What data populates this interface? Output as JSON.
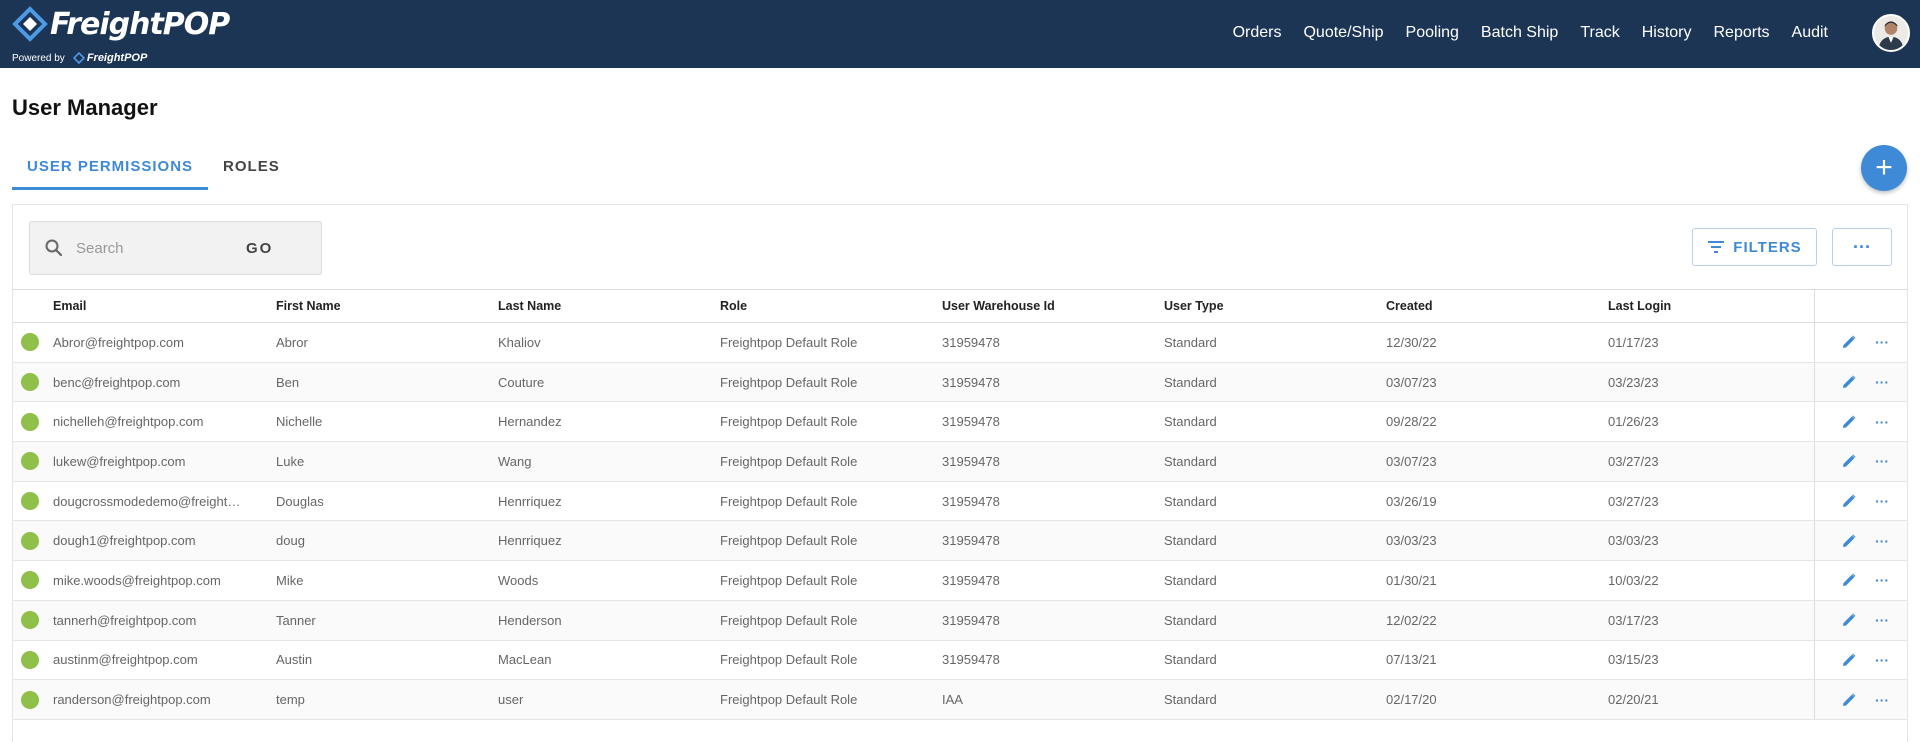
{
  "header": {
    "brand": "FreightPOP",
    "powered_by": "Powered by",
    "powered_brand": "FreightPOP",
    "nav": [
      "Orders",
      "Quote/Ship",
      "Pooling",
      "Batch Ship",
      "Track",
      "History",
      "Reports",
      "Audit"
    ]
  },
  "page": {
    "title": "User Manager",
    "tabs": [
      {
        "label": "USER PERMISSIONS",
        "active": true
      },
      {
        "label": "ROLES",
        "active": false
      }
    ],
    "add_button": "+"
  },
  "toolbar": {
    "search_placeholder": "Search",
    "go_label": "GO",
    "filters_label": "FILTERS",
    "more_label": "···"
  },
  "table": {
    "columns": [
      "Email",
      "First Name",
      "Last Name",
      "Role",
      "User Warehouse Id",
      "User Type",
      "Created",
      "Last Login"
    ],
    "rows": [
      {
        "email": "Abror@freightpop.com",
        "first": "Abror",
        "last": "Khaliov",
        "role": "Freightpop Default Role",
        "warehouse": "31959478",
        "type": "Standard",
        "created": "12/30/22",
        "login": "01/17/23"
      },
      {
        "email": "benc@freightpop.com",
        "first": "Ben",
        "last": "Couture",
        "role": "Freightpop Default Role",
        "warehouse": "31959478",
        "type": "Standard",
        "created": "03/07/23",
        "login": "03/23/23"
      },
      {
        "email": "nichelleh@freightpop.com",
        "first": "Nichelle",
        "last": "Hernandez",
        "role": "Freightpop Default Role",
        "warehouse": "31959478",
        "type": "Standard",
        "created": "09/28/22",
        "login": "01/26/23"
      },
      {
        "email": "lukew@freightpop.com",
        "first": "Luke",
        "last": "Wang",
        "role": "Freightpop Default Role",
        "warehouse": "31959478",
        "type": "Standard",
        "created": "03/07/23",
        "login": "03/27/23"
      },
      {
        "email": "dougcrossmodedemo@freightp...",
        "first": "Douglas",
        "last": "Henrriquez",
        "role": "Freightpop Default Role",
        "warehouse": "31959478",
        "type": "Standard",
        "created": "03/26/19",
        "login": "03/27/23"
      },
      {
        "email": "dough1@freightpop.com",
        "first": "doug",
        "last": "Henrriquez",
        "role": "Freightpop Default Role",
        "warehouse": "31959478",
        "type": "Standard",
        "created": "03/03/23",
        "login": "03/03/23"
      },
      {
        "email": "mike.woods@freightpop.com",
        "first": "Mike",
        "last": "Woods",
        "role": "Freightpop Default Role",
        "warehouse": "31959478",
        "type": "Standard",
        "created": "01/30/21",
        "login": "10/03/22"
      },
      {
        "email": "tannerh@freightpop.com",
        "first": "Tanner",
        "last": "Henderson",
        "role": "Freightpop Default Role",
        "warehouse": "31959478",
        "type": "Standard",
        "created": "12/02/22",
        "login": "03/17/23"
      },
      {
        "email": "austinm@freightpop.com",
        "first": "Austin",
        "last": "MacLean",
        "role": "Freightpop Default Role",
        "warehouse": "31959478",
        "type": "Standard",
        "created": "07/13/21",
        "login": "03/15/23"
      },
      {
        "email": "randerson@freightpop.com",
        "first": "temp",
        "last": "user",
        "role": "Freightpop Default Role",
        "warehouse": "IAA",
        "type": "Standard",
        "created": "02/17/20",
        "login": "02/20/21"
      }
    ]
  },
  "colors": {
    "header_bg": "#1c3554",
    "accent": "#3f8ad6",
    "status_active": "#8fc04a"
  }
}
